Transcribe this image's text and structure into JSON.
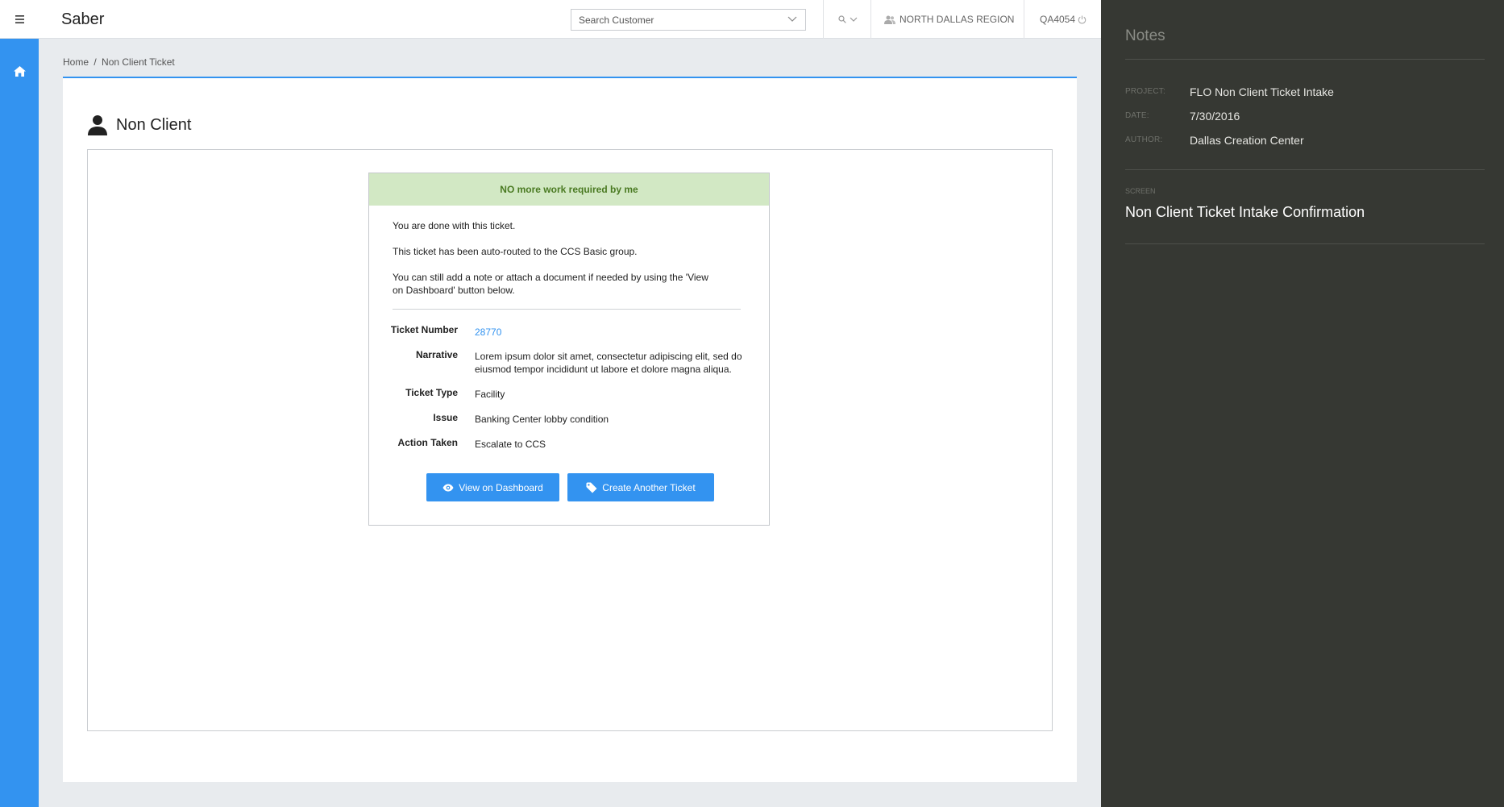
{
  "header": {
    "app_title": "Saber",
    "search_placeholder": "Search Customer",
    "region": "NORTH DALLAS REGION",
    "user_id": "QA4054"
  },
  "breadcrumb": {
    "home": "Home",
    "separator": "/",
    "current": "Non Client Ticket"
  },
  "page": {
    "heading": "Non Client"
  },
  "confirmation": {
    "banner": "NO more work required by me",
    "messages": [
      "You are done with this ticket.",
      "This ticket has been auto-routed to the CCS Basic group.",
      "You can still add a note or attach a document if needed by using the 'View on Dashboard' button below."
    ],
    "fields": [
      {
        "label": "Ticket Number",
        "value": "28770"
      },
      {
        "label": "Narrative",
        "value": "Lorem ipsum dolor sit amet, consectetur adipiscing elit, sed do eiusmod tempor incididunt ut labore et dolore magna aliqua."
      },
      {
        "label": "Ticket Type",
        "value": "Facility"
      },
      {
        "label": "Issue",
        "value": "Banking Center lobby condition"
      },
      {
        "label": "Action Taken",
        "value": "Escalate to CCS"
      }
    ],
    "buttons": {
      "view_dashboard": "View on Dashboard",
      "create_ticket": "Create Another Ticket"
    }
  },
  "notes": {
    "title": "Notes",
    "project_label": "PROJECT:",
    "project": "FLO Non Client Ticket Intake",
    "date_label": "DATE:",
    "date": "7/30/2016",
    "author_label": "AUTHOR:",
    "author": "Dallas Creation Center",
    "screen_label": "SCREEN",
    "screen": "Non Client Ticket Intake Confirmation"
  },
  "colors": {
    "accent": "#3393f0",
    "banner_bg": "#d2e8c4",
    "banner_text": "#4a7a22",
    "notes_bg": "#363833"
  },
  "icons": [
    "hamburger-icon",
    "home-icon",
    "chevron-down-icon",
    "search-icon",
    "users-icon",
    "power-icon",
    "person-icon",
    "eye-icon",
    "tag-icon"
  ]
}
